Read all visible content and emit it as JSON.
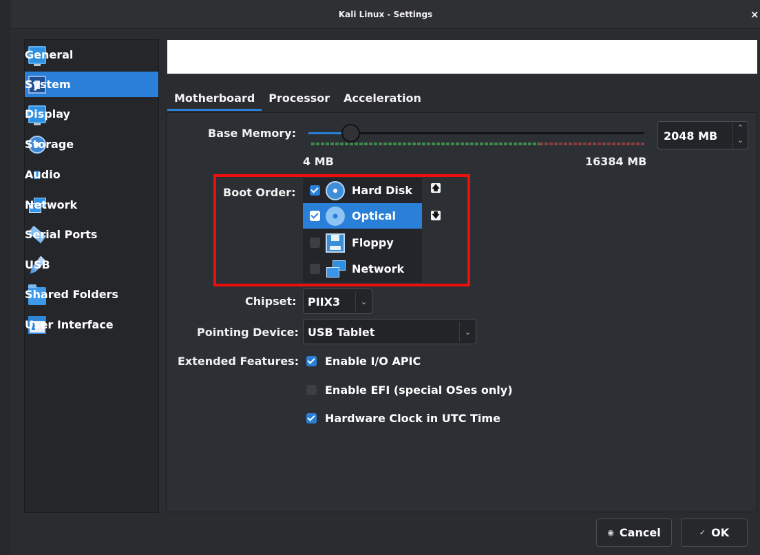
{
  "window": {
    "title": "Kali Linux - Settings",
    "close_glyph": "×"
  },
  "sidebar": {
    "items": [
      {
        "label": "General",
        "icon": "monitor-icon"
      },
      {
        "label": "System",
        "icon": "chip-icon",
        "active": true
      },
      {
        "label": "Display",
        "icon": "display-icon"
      },
      {
        "label": "Storage",
        "icon": "storage-icon"
      },
      {
        "label": "Audio",
        "icon": "audio-icon"
      },
      {
        "label": "Network",
        "icon": "network-icon"
      },
      {
        "label": "Serial Ports",
        "icon": "serial-port-icon"
      },
      {
        "label": "USB",
        "icon": "usb-icon"
      },
      {
        "label": "Shared Folders",
        "icon": "folder-icon"
      },
      {
        "label": "User Interface",
        "icon": "user-interface-icon"
      }
    ]
  },
  "tabs": [
    {
      "label": "Motherboard",
      "active": true
    },
    {
      "label": "Processor"
    },
    {
      "label": "Acceleration"
    }
  ],
  "motherboard": {
    "base_memory": {
      "label": "Base Memory:",
      "min_label": "4 MB",
      "max_label": "16384 MB",
      "value": "2048 MB",
      "min": 4,
      "max": 16384,
      "current": 2048
    },
    "boot_order": {
      "label": "Boot Order:",
      "devices": [
        {
          "label": "Hard Disk",
          "checked": true,
          "icon": "hard-disk-icon"
        },
        {
          "label": "Optical",
          "checked": true,
          "selected": true,
          "icon": "optical-disc-icon"
        },
        {
          "label": "Floppy",
          "checked": false,
          "icon": "floppy-icon"
        },
        {
          "label": "Network",
          "checked": false,
          "icon": "network-icon"
        }
      ],
      "move_up_glyph": "🡅",
      "move_down_glyph": "🡇"
    },
    "chipset": {
      "label": "Chipset:",
      "value": "PIIX3"
    },
    "pointing_device": {
      "label": "Pointing Device:",
      "value": "USB Tablet"
    },
    "extended_features": {
      "label": "Extended Features:",
      "options": [
        {
          "label": "Enable I/O APIC",
          "checked": true
        },
        {
          "label": "Enable EFI (special OSes only)",
          "checked": false
        },
        {
          "label": "Hardware Clock in UTC Time",
          "checked": true
        }
      ]
    }
  },
  "buttons": {
    "cancel": {
      "label": "Cancel",
      "glyph": "◉"
    },
    "ok": {
      "label": "OK",
      "glyph": "✓"
    }
  },
  "colors": {
    "accent": "#2a80d8",
    "highlight_box": "#f20d0d"
  }
}
